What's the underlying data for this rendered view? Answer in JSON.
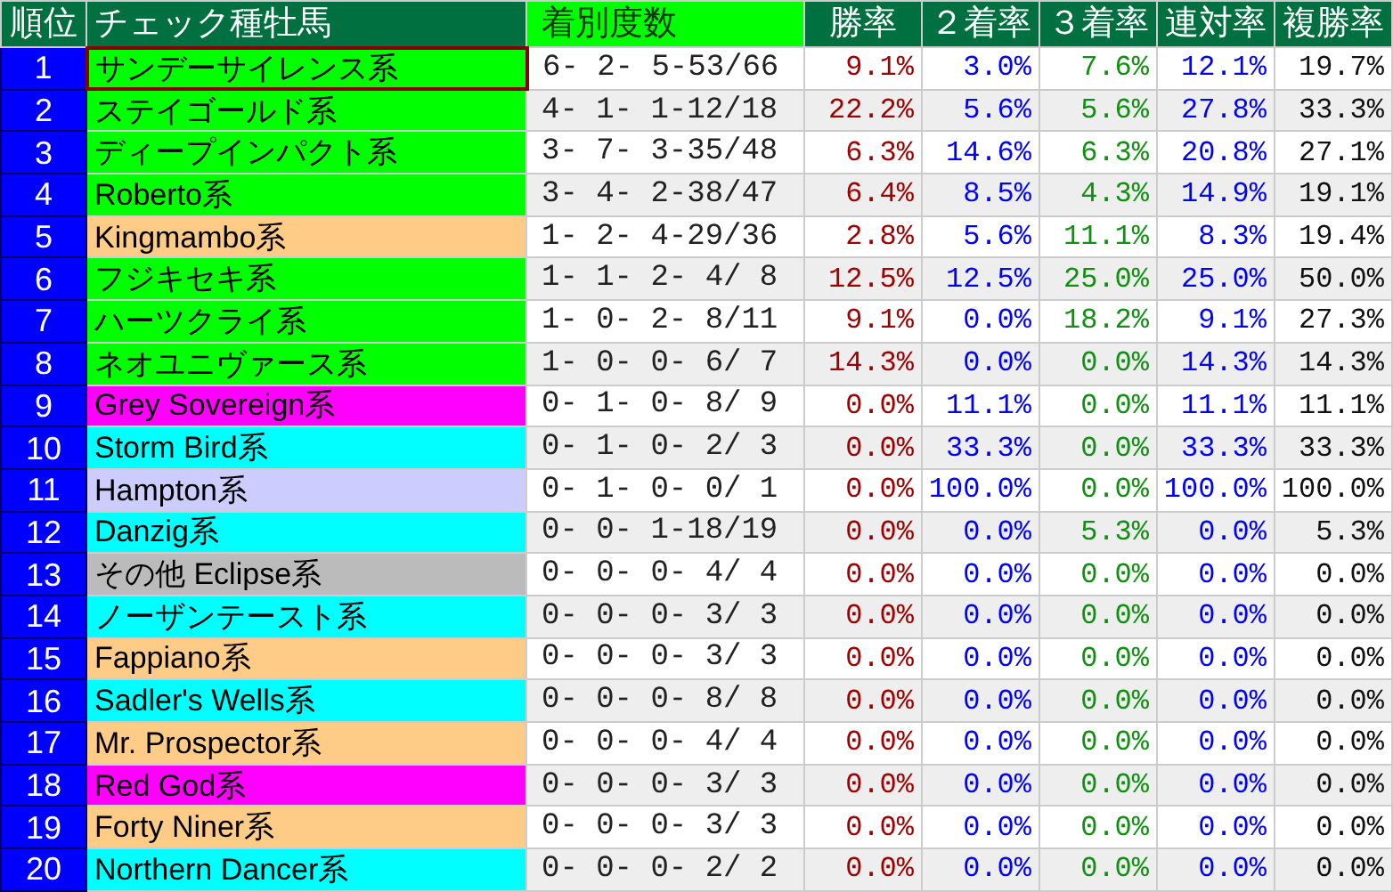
{
  "columns": [
    {
      "label": "順位",
      "kind": "rank"
    },
    {
      "label": "チェック種牡馬",
      "kind": "name"
    },
    {
      "label": "着別度数",
      "kind": "record"
    },
    {
      "label": "勝率",
      "kind": "rate"
    },
    {
      "label": "２着率",
      "kind": "rate"
    },
    {
      "label": "３着率",
      "kind": "rate"
    },
    {
      "label": "連対率",
      "kind": "rate"
    },
    {
      "label": "複勝率",
      "kind": "rate"
    }
  ],
  "rows": [
    {
      "rank": "1",
      "name": "サンデーサイレンス系",
      "color": "#00ff00",
      "selected": true,
      "record": "6- 2- 5-53/66",
      "rates": [
        "9.1%",
        "3.0%",
        "7.6%",
        "12.1%",
        "19.7%"
      ]
    },
    {
      "rank": "2",
      "name": "ステイゴールド系",
      "color": "#00ff00",
      "selected": false,
      "record": "4- 1- 1-12/18",
      "rates": [
        "22.2%",
        "5.6%",
        "5.6%",
        "27.8%",
        "33.3%"
      ]
    },
    {
      "rank": "3",
      "name": "ディープインパクト系",
      "color": "#00ff00",
      "selected": false,
      "record": "3- 7- 3-35/48",
      "rates": [
        "6.3%",
        "14.6%",
        "6.3%",
        "20.8%",
        "27.1%"
      ]
    },
    {
      "rank": "4",
      "name": "Roberto系",
      "color": "#00ff00",
      "selected": false,
      "record": "3- 4- 2-38/47",
      "rates": [
        "6.4%",
        "8.5%",
        "4.3%",
        "14.9%",
        "19.1%"
      ]
    },
    {
      "rank": "5",
      "name": "Kingmambo系",
      "color": "#ffcc88",
      "selected": false,
      "record": "1- 2- 4-29/36",
      "rates": [
        "2.8%",
        "5.6%",
        "11.1%",
        "8.3%",
        "19.4%"
      ]
    },
    {
      "rank": "6",
      "name": "フジキセキ系",
      "color": "#00ff00",
      "selected": false,
      "record": "1- 1- 2- 4/ 8",
      "rates": [
        "12.5%",
        "12.5%",
        "25.0%",
        "25.0%",
        "50.0%"
      ]
    },
    {
      "rank": "7",
      "name": "ハーツクライ系",
      "color": "#00ff00",
      "selected": false,
      "record": "1- 0- 2- 8/11",
      "rates": [
        "9.1%",
        "0.0%",
        "18.2%",
        "9.1%",
        "27.3%"
      ]
    },
    {
      "rank": "8",
      "name": "ネオユニヴァース系",
      "color": "#00ff00",
      "selected": false,
      "record": "1- 0- 0- 6/ 7",
      "rates": [
        "14.3%",
        "0.0%",
        "0.0%",
        "14.3%",
        "14.3%"
      ]
    },
    {
      "rank": "9",
      "name": "Grey Sovereign系",
      "color": "#ff00ff",
      "selected": false,
      "record": "0- 1- 0- 8/ 9",
      "rates": [
        "0.0%",
        "11.1%",
        "0.0%",
        "11.1%",
        "11.1%"
      ]
    },
    {
      "rank": "10",
      "name": "Storm Bird系",
      "color": "#00ffff",
      "selected": false,
      "record": "0- 1- 0- 2/ 3",
      "rates": [
        "0.0%",
        "33.3%",
        "0.0%",
        "33.3%",
        "33.3%"
      ]
    },
    {
      "rank": "11",
      "name": "Hampton系",
      "color": "#ccccff",
      "selected": false,
      "record": "0- 1- 0- 0/ 1",
      "rates": [
        "0.0%",
        "100.0%",
        "0.0%",
        "100.0%",
        "100.0%"
      ]
    },
    {
      "rank": "12",
      "name": "Danzig系",
      "color": "#00ffff",
      "selected": false,
      "record": "0- 0- 1-18/19",
      "rates": [
        "0.0%",
        "0.0%",
        "5.3%",
        "0.0%",
        "5.3%"
      ]
    },
    {
      "rank": "13",
      "name": "その他 Eclipse系",
      "color": "#bbbbbb",
      "selected": false,
      "record": "0- 0- 0- 4/ 4",
      "rates": [
        "0.0%",
        "0.0%",
        "0.0%",
        "0.0%",
        "0.0%"
      ]
    },
    {
      "rank": "14",
      "name": "ノーザンテースト系",
      "color": "#00ffff",
      "selected": false,
      "record": "0- 0- 0- 3/ 3",
      "rates": [
        "0.0%",
        "0.0%",
        "0.0%",
        "0.0%",
        "0.0%"
      ]
    },
    {
      "rank": "15",
      "name": "Fappiano系",
      "color": "#ffcc88",
      "selected": false,
      "record": "0- 0- 0- 3/ 3",
      "rates": [
        "0.0%",
        "0.0%",
        "0.0%",
        "0.0%",
        "0.0%"
      ]
    },
    {
      "rank": "16",
      "name": "Sadler's Wells系",
      "color": "#00ffff",
      "selected": false,
      "record": "0- 0- 0- 8/ 8",
      "rates": [
        "0.0%",
        "0.0%",
        "0.0%",
        "0.0%",
        "0.0%"
      ]
    },
    {
      "rank": "17",
      "name": "Mr. Prospector系",
      "color": "#ffcc88",
      "selected": false,
      "record": "0- 0- 0- 4/ 4",
      "rates": [
        "0.0%",
        "0.0%",
        "0.0%",
        "0.0%",
        "0.0%"
      ]
    },
    {
      "rank": "18",
      "name": "Red God系",
      "color": "#ff00ff",
      "selected": false,
      "record": "0- 0- 0- 3/ 3",
      "rates": [
        "0.0%",
        "0.0%",
        "0.0%",
        "0.0%",
        "0.0%"
      ]
    },
    {
      "rank": "19",
      "name": "Forty Niner系",
      "color": "#ffcc88",
      "selected": false,
      "record": "0- 0- 0- 3/ 3",
      "rates": [
        "0.0%",
        "0.0%",
        "0.0%",
        "0.0%",
        "0.0%"
      ]
    },
    {
      "rank": "20",
      "name": "Northern Dancer系",
      "color": "#00ffff",
      "selected": false,
      "record": "0- 0- 0- 2/ 2",
      "rates": [
        "0.0%",
        "0.0%",
        "0.0%",
        "0.0%",
        "0.0%"
      ]
    }
  ]
}
